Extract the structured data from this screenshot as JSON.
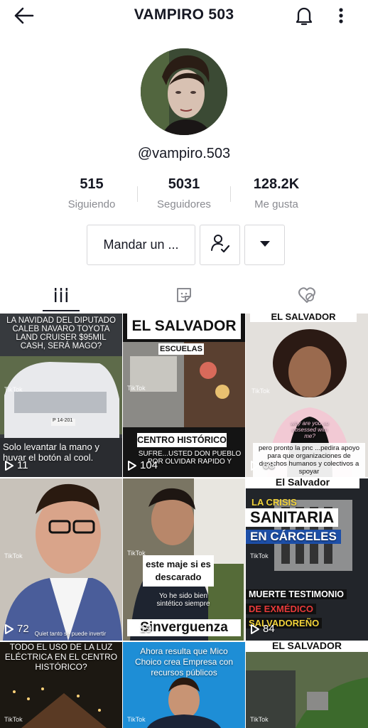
{
  "header": {
    "title": "VAMPIRO 503",
    "back_icon": "arrow-left-icon",
    "bell_icon": "bell-icon",
    "more_icon": "vertical-dots-icon"
  },
  "profile": {
    "username": "@vampiro.503",
    "stats": [
      {
        "value": "515",
        "label": "Siguiendo"
      },
      {
        "value": "5031",
        "label": "Seguidores"
      },
      {
        "value": "128.2K",
        "label": "Me gusta"
      }
    ]
  },
  "actions": {
    "message_label": "Mandar un ...",
    "follow_icon": "user-check-icon",
    "dropdown_icon": "caret-down-icon"
  },
  "tabs": [
    {
      "icon": "grid-bars-icon",
      "active": true
    },
    {
      "icon": "sticker-icon",
      "active": false
    },
    {
      "icon": "heart-hidden-icon",
      "active": false
    }
  ],
  "videos": [
    {
      "top_text": "LA NAVIDAD DEL DIPUTADO CALEB NAVARO TOYOTA LAND CRUISER $95MIL CASH, SERÁ MAGO?",
      "bottom_text": "Solo levantar la mano  y  huvar el botón al cool.",
      "plate": "P 14-201",
      "views": "11",
      "watermark": "TikTok"
    },
    {
      "top_text": "EL SALVADOR",
      "sub_label": "ESCUELAS",
      "center_label": "CENTRO HISTÓRICO",
      "bottom_text": "SUFRE...USTED DON PUEBLO POR OLVIDAR RAPIDO Y",
      "views": "104",
      "watermark": "TikTok"
    },
    {
      "top_text": "EL SALVADOR",
      "shirt_text": "why are you so obsessed with me?",
      "bottom_text": "pero pronto la pnc ...pedira apoyo para que organizaciones de derechos humanos y colectivos a spoyar",
      "views": "68",
      "watermark": "TikTok"
    },
    {
      "bottom_text": "Quiet tanto se puede invertir",
      "views": "72",
      "watermark": "TikTok"
    },
    {
      "center_label": "este maje si es descarado",
      "sub_text": "Yo he sido bien sintético siempre",
      "bottom_label": "Sinverguenza",
      "views": "19",
      "watermark": "TikTok"
    },
    {
      "top_text": "El Salvador",
      "line1": "LA CRISIS",
      "line2": "SANITARIA",
      "line3": "EN CÁRCELES",
      "line4": "MUERTE TESTIMONIO",
      "line5": "DE EXMÉDICO",
      "line6": "SALVADOREÑO",
      "views": "84",
      "watermark": "TikTok"
    },
    {
      "top_text": "TODO EL USO DE LA LUZ ELÉCTRICA EN EL CENTRO HISTÓRICO?",
      "watermark": "TikTok"
    },
    {
      "top_text": "Ahora resulta que Mico Choico crea Empresa con recursos públicos",
      "watermark": "TikTok"
    },
    {
      "top_text": "EL SALVADOR",
      "watermark": "TikTok"
    }
  ]
}
